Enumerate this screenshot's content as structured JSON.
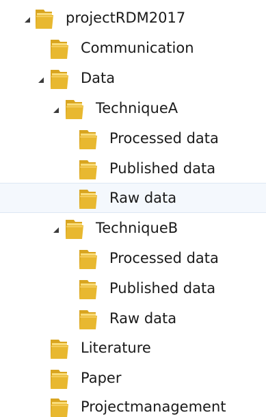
{
  "tree": {
    "root": {
      "label": "projectRDM2017",
      "icon": "folder-icon",
      "expanded": true,
      "children": [
        {
          "label": "Communication",
          "icon": "folder-icon"
        },
        {
          "label": "Data",
          "icon": "folder-icon",
          "expanded": true,
          "children": [
            {
              "label": "TechniqueA",
              "icon": "folder-icon",
              "expanded": true,
              "children": [
                {
                  "label": "Processed data",
                  "icon": "folder-icon"
                },
                {
                  "label": "Published data",
                  "icon": "folder-icon"
                },
                {
                  "label": "Raw data",
                  "icon": "folder-icon",
                  "hovered": true
                }
              ]
            },
            {
              "label": "TechniqueB",
              "icon": "folder-icon",
              "expanded": true,
              "children": [
                {
                  "label": "Processed data",
                  "icon": "folder-icon"
                },
                {
                  "label": "Published data",
                  "icon": "folder-icon"
                },
                {
                  "label": "Raw data",
                  "icon": "folder-icon"
                }
              ]
            }
          ]
        },
        {
          "label": "Literature",
          "icon": "folder-icon"
        },
        {
          "label": "Paper",
          "icon": "folder-icon"
        },
        {
          "label": "Projectmanagement",
          "icon": "folder-icon"
        }
      ]
    }
  },
  "colors": {
    "hover_background": "#f4f8fd",
    "hover_border": "#dce7f3",
    "folder_body": "#e8b830",
    "folder_light": "#f9dc7a",
    "arrow": "#3b3b3b"
  }
}
